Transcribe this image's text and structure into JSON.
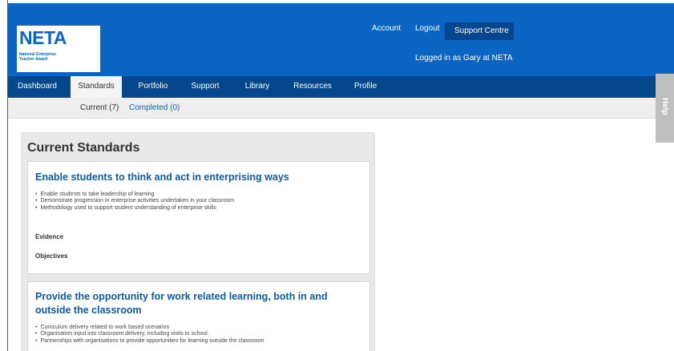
{
  "logo": {
    "name": "NETA",
    "subtitle_line1": "National Enterprise",
    "subtitle_line2": "Teacher Award"
  },
  "top_nav": {
    "account": "Account",
    "logout": "Logout",
    "support_centre": "Support Centre",
    "logged_in": "Logged in as Gary at NETA"
  },
  "main_nav": {
    "items": [
      {
        "label": "Dashboard"
      },
      {
        "label": "Standards"
      },
      {
        "label": "Portfolio"
      },
      {
        "label": "Support"
      },
      {
        "label": "Library"
      },
      {
        "label": "Resources"
      },
      {
        "label": "Profile"
      }
    ],
    "active": "Standards"
  },
  "sub_nav": {
    "current": "Current (7)",
    "completed": "Completed (0)"
  },
  "help_tab": {
    "label": "Help"
  },
  "panel": {
    "title": "Current Standards",
    "standards": [
      {
        "title": "Enable students to think and act in enterprising ways",
        "bullets": [
          "Enable students to take leadership of learning",
          "Demonstrate progression in enterprise activities undertaken in your classroom",
          "Methodology used to support student understanding of enterprise skills"
        ],
        "evidence_label": "Evidence",
        "objectives_label": "Objectives"
      },
      {
        "title": "Provide the opportunity for work related learning, both in and outside the classroom",
        "bullets": [
          "Curriculum delivery related to work based scenarios",
          "Organisation input into classroom delivery, including visits to school.",
          "Partnerships with organisations to provide opportunities for learning outside the classroom"
        ]
      }
    ]
  },
  "colors": {
    "header_blue": "#0a66c2",
    "nav_blue": "#05478c",
    "link_blue": "#0f5aa0",
    "panel_grey": "#e9e9e9"
  }
}
